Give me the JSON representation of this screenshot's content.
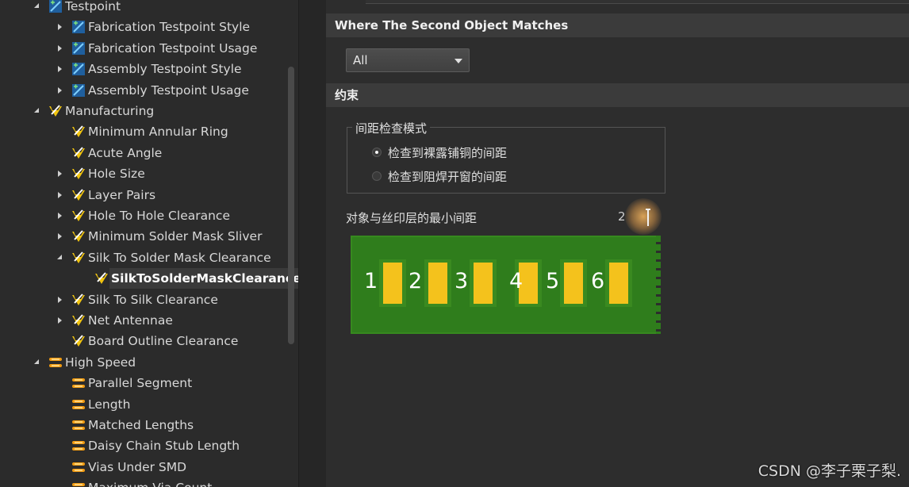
{
  "tree": {
    "items": [
      {
        "label": "Testpoint",
        "level": 0,
        "expander": "down",
        "icon": "testpoint-icon"
      },
      {
        "label": "Fabrication Testpoint Style",
        "level": 1,
        "expander": "right",
        "icon": "testpoint-icon"
      },
      {
        "label": "Fabrication Testpoint Usage",
        "level": 1,
        "expander": "right",
        "icon": "testpoint-icon"
      },
      {
        "label": "Assembly Testpoint Style",
        "level": 1,
        "expander": "right",
        "icon": "testpoint-icon"
      },
      {
        "label": "Assembly Testpoint Usage",
        "level": 1,
        "expander": "right",
        "icon": "testpoint-icon"
      },
      {
        "label": "Manufacturing",
        "level": 0,
        "expander": "down",
        "icon": "manufacturing-rule-icon"
      },
      {
        "label": "Minimum Annular Ring",
        "level": 1,
        "expander": "none",
        "icon": "manufacturing-rule-icon"
      },
      {
        "label": "Acute Angle",
        "level": 1,
        "expander": "none",
        "icon": "manufacturing-rule-icon"
      },
      {
        "label": "Hole Size",
        "level": 1,
        "expander": "right",
        "icon": "manufacturing-rule-icon"
      },
      {
        "label": "Layer Pairs",
        "level": 1,
        "expander": "right",
        "icon": "manufacturing-rule-icon"
      },
      {
        "label": "Hole To Hole Clearance",
        "level": 1,
        "expander": "right",
        "icon": "manufacturing-rule-icon"
      },
      {
        "label": "Minimum Solder Mask Sliver",
        "level": 1,
        "expander": "right",
        "icon": "manufacturing-rule-icon"
      },
      {
        "label": "Silk To Solder Mask Clearance",
        "level": 1,
        "expander": "down",
        "icon": "manufacturing-rule-icon"
      },
      {
        "label": "SilkToSolderMaskClearance",
        "level": 2,
        "expander": "none",
        "icon": "manufacturing-rule-icon",
        "selected": true
      },
      {
        "label": "Silk To Silk Clearance",
        "level": 1,
        "expander": "right",
        "icon": "manufacturing-rule-icon"
      },
      {
        "label": "Net Antennae",
        "level": 1,
        "expander": "right",
        "icon": "manufacturing-rule-icon"
      },
      {
        "label": "Board Outline Clearance",
        "level": 1,
        "expander": "none",
        "icon": "manufacturing-rule-icon"
      },
      {
        "label": "High Speed",
        "level": 0,
        "expander": "down",
        "icon": "high-speed-icon"
      },
      {
        "label": "Parallel Segment",
        "level": 1,
        "expander": "none",
        "icon": "high-speed-icon"
      },
      {
        "label": "Length",
        "level": 1,
        "expander": "none",
        "icon": "high-speed-icon"
      },
      {
        "label": "Matched Lengths",
        "level": 1,
        "expander": "none",
        "icon": "high-speed-icon"
      },
      {
        "label": "Daisy Chain Stub Length",
        "level": 1,
        "expander": "none",
        "icon": "high-speed-icon"
      },
      {
        "label": "Vias Under SMD",
        "level": 1,
        "expander": "none",
        "icon": "high-speed-icon"
      },
      {
        "label": "Maximum Via Count",
        "level": 1,
        "expander": "none",
        "icon": "high-speed-icon"
      }
    ]
  },
  "main": {
    "second_object_heading": "Where The Second Object Matches",
    "dropdown_value": "All",
    "constraints_heading": "约束",
    "check_mode_legend": "间距检查模式",
    "radio_exposed_copper": "检查到裸露铺铜的间距",
    "radio_solder_mask": "检查到阻焊开窗的间距",
    "min_distance_label": "对象与丝印层的最小间距",
    "min_distance_value": "2",
    "pad_numbers": [
      "1",
      "2",
      "3",
      "4",
      "5",
      "6"
    ]
  },
  "watermark": "CSDN @李子栗子梨.",
  "colors": {
    "board_green": "#2f7d1c",
    "pad_yellow": "#f4c21c",
    "panel_bg": "#2d2d2d",
    "header_bg": "#3b3b3b"
  }
}
